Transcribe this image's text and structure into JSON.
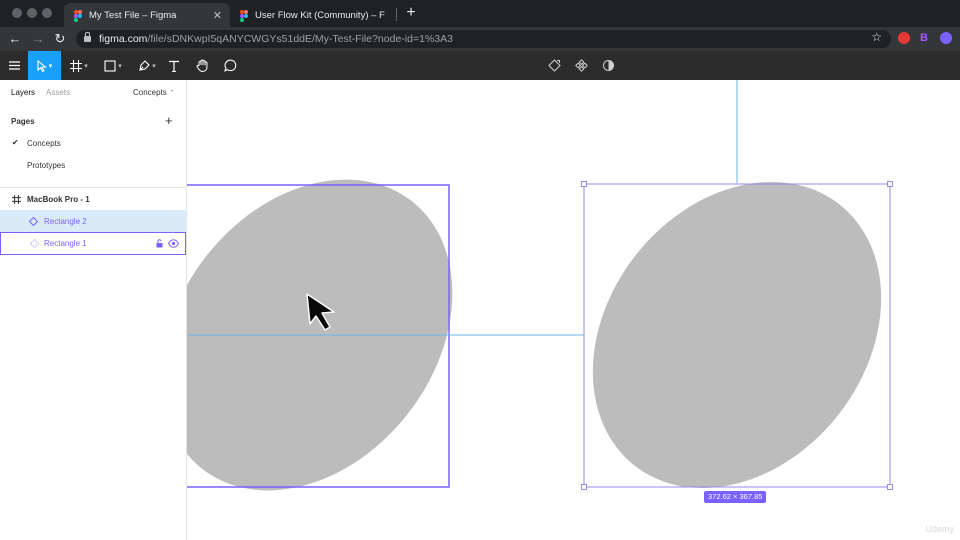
{
  "browser": {
    "tabs": [
      {
        "title": "My Test File – Figma",
        "active": true
      },
      {
        "title": "User Flow Kit (Community) – F",
        "active": false
      }
    ],
    "new_tab": "+",
    "close_glyph": "✕",
    "url_host": "figma.com",
    "url_path": "/file/sDNKwpI5qANYCWGYs51ddE/My-Test-File?node-id=1%3A3",
    "extension_letter": "B"
  },
  "left_panel": {
    "tabs": {
      "layers": "Layers",
      "assets": "Assets",
      "current_page": "Concepts"
    },
    "pages_header": "Pages",
    "pages": [
      {
        "name": "Concepts",
        "checked": true,
        "check_glyph": "✔"
      },
      {
        "name": "Prototypes",
        "checked": false,
        "check_glyph": ""
      }
    ],
    "layers": [
      {
        "name": "MacBook Pro - 1",
        "type": "frame"
      },
      {
        "name": "Rectangle 2",
        "type": "component",
        "selected": true
      },
      {
        "name": "Rectangle 1",
        "type": "instance",
        "hovered": true
      }
    ]
  },
  "canvas": {
    "dimension_label": "372.62 × 367.85",
    "watermark": "Udemy"
  },
  "colors": {
    "accent": "#18a0fb",
    "selection": "#7b61ff",
    "shape_fill": "#bcbcbc",
    "guide": "#6ab7e6"
  }
}
